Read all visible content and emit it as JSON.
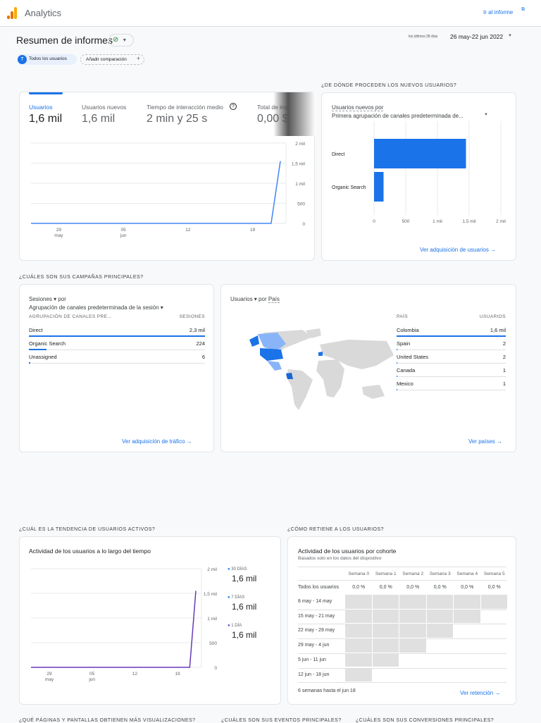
{
  "header": {
    "app": "Analytics",
    "go_report": "Ir al informe"
  },
  "page": {
    "title": "Resumen de informes",
    "date_label": "los últimos 28 días",
    "date_range": "26 may-22 jun 2022",
    "segment_letter": "T",
    "segment": "Todos los usuarios",
    "add_comparison": "Añadir comparación"
  },
  "metrics": [
    {
      "label": "Usuarios",
      "value": "1,6 mil"
    },
    {
      "label": "Usuarios nuevos",
      "value": "1,6 mil"
    },
    {
      "label": "Tiempo de interacción medio",
      "value": "2 min y 25 s"
    },
    {
      "label": "Total de ingresos",
      "value": "0,00 $"
    }
  ],
  "users_chart": {
    "type": "line",
    "y_ticks": [
      "2 mil",
      "1,5 mil",
      "1 mil",
      "500",
      "0"
    ],
    "x_ticks": [
      [
        "29",
        "may"
      ],
      [
        "05",
        "jun"
      ],
      [
        "12",
        ""
      ],
      [
        "19",
        ""
      ]
    ],
    "values": [
      0,
      0,
      0,
      0,
      0,
      0,
      0,
      0,
      0,
      0,
      0,
      0,
      0,
      0,
      0,
      0,
      0,
      0,
      0,
      0,
      0,
      0,
      0,
      0,
      0,
      0,
      0,
      1550
    ],
    "ymax": 2000
  },
  "acquisition": {
    "heading": "¿De dónde proceden los nuevos usuarios?",
    "metric": "Usuarios nuevos por",
    "dimension": "Primera agrupación de canales predeterminada de...",
    "chart_data": {
      "type": "bar",
      "categories": [
        "Direct",
        "Organic Search"
      ],
      "values": [
        1450,
        150
      ],
      "x_ticks": [
        "0",
        "500",
        "1 mil",
        "1,5 mil",
        "2 mil"
      ],
      "xmax": 2000
    },
    "link": "Ver adquisición de usuarios"
  },
  "campaigns": {
    "heading": "¿Cuáles son sus campañas principales?",
    "metric": "Sesiones",
    "by": "por",
    "dimension": "Agrupación de canales predeterminada de la sesión",
    "col1": "AGRUPACIÓN DE CANALES PRE...",
    "col2": "SESIONES",
    "rows": [
      {
        "name": "Direct",
        "value": "2,3 mil",
        "frac": 1
      },
      {
        "name": "Organic Search",
        "value": "224",
        "frac": 0.1
      },
      {
        "name": "Unassigned",
        "value": "6",
        "frac": 0.003
      }
    ],
    "link": "Ver adquisición de tráfico"
  },
  "countries": {
    "metric": "Usuarios",
    "by": "por",
    "dimension": "País",
    "col1": "PAÍS",
    "col2": "USUARIOS",
    "rows": [
      {
        "name": "Colombia",
        "value": "1,6 mil",
        "frac": 1
      },
      {
        "name": "Spain",
        "value": "2",
        "frac": 0.001
      },
      {
        "name": "United States",
        "value": "2",
        "frac": 0.001
      },
      {
        "name": "Canada",
        "value": "1",
        "frac": 0.001
      },
      {
        "name": "Mexico",
        "value": "1",
        "frac": 0.001
      }
    ],
    "link": "Ver países"
  },
  "active": {
    "heading": "¿Cuál es la tendencia de usuarios activos?",
    "title": "Actividad de los usuarios a lo largo del tiempo",
    "y_ticks": [
      "2 mil",
      "1,5 mil",
      "1 mil",
      "500",
      "0"
    ],
    "x_ticks": [
      [
        "29",
        "may"
      ],
      [
        "05",
        "jun"
      ],
      [
        "12",
        ""
      ],
      [
        "19",
        ""
      ]
    ],
    "values": [
      0,
      0,
      0,
      0,
      0,
      0,
      0,
      0,
      0,
      0,
      0,
      0,
      0,
      0,
      0,
      0,
      0,
      0,
      0,
      0,
      0,
      0,
      0,
      0,
      0,
      0,
      0,
      1550
    ],
    "ymax": 2000,
    "legend": [
      {
        "label": "30 DÍAS",
        "value": "1,6 mil"
      },
      {
        "label": "7 DÍAS",
        "value": "1,6 mil"
      },
      {
        "label": "1 DÍA",
        "value": "1,6 mil"
      }
    ]
  },
  "retention": {
    "heading": "¿Cómo retiene a los usuarios?",
    "title": "Actividad de los usuarios por cohorte",
    "subtitle": "Basados solo en los datos del dispositivo",
    "weeks": [
      "Semana 0",
      "Semana 1",
      "Semana 2",
      "Semana 3",
      "Semana 4",
      "Semana 5"
    ],
    "all_label": "Todos los usuarios",
    "all_values": [
      "0,0 %",
      "0,0 %",
      "0,0 %",
      "0,0 %",
      "0,0 %",
      "0,0 %"
    ],
    "cohorts": [
      "8 may - 14 may",
      "15 may - 21 may",
      "22 may - 28 may",
      "29 may - 4 jun",
      "5 jun - 11 jun",
      "12 jun - 18 jun"
    ],
    "footer": "6 semanas hasta el jun 18",
    "link": "Ver retención"
  },
  "bottom_headings": [
    "¿Qué páginas y pantallas obtienen más visualizaciones?",
    "¿Cuáles son sus eventos principales?",
    "¿Cuáles son sus conversiones principales?"
  ],
  "colors": {
    "accent": "#1a73e8",
    "line": "#4285f4",
    "purple": "#673ab7"
  }
}
